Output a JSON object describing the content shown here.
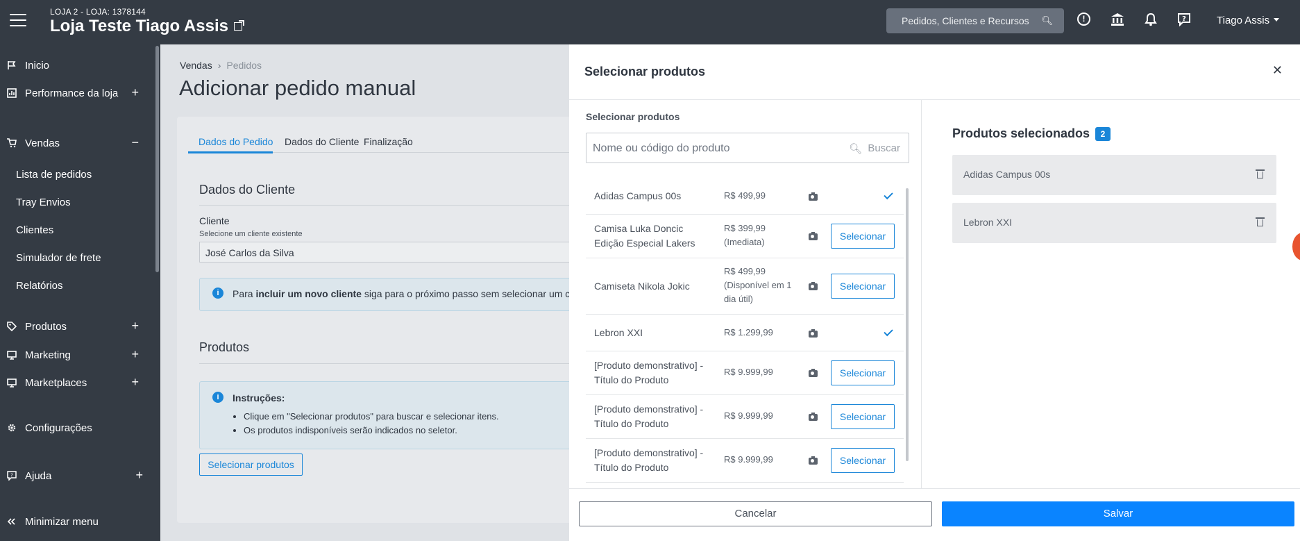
{
  "header": {
    "store_code": "LOJA 2 - LOJA: 1378144",
    "store_name": "Loja Teste Tiago Assis",
    "search_placeholder": "Pedidos, Clientes e Recursos",
    "user_name": "Tiago Assis"
  },
  "sidebar": {
    "items": [
      {
        "label": "Inicio",
        "icon": "flag-icon",
        "toggle": ""
      },
      {
        "label": "Performance da loja",
        "icon": "chart-icon",
        "toggle": "+"
      },
      {
        "label": "Vendas",
        "icon": "cart-icon",
        "toggle": "−"
      },
      {
        "label": "Produtos",
        "icon": "tag-icon",
        "toggle": "+"
      },
      {
        "label": "Marketing",
        "icon": "monitor-icon",
        "toggle": "+"
      },
      {
        "label": "Marketplaces",
        "icon": "monitor-icon",
        "toggle": "+"
      },
      {
        "label": "Configurações",
        "icon": "gear-icon",
        "toggle": ""
      },
      {
        "label": "Ajuda",
        "icon": "chat-help-icon",
        "toggle": "+"
      },
      {
        "label": "Minimizar menu",
        "icon": "double-chevron-left-icon",
        "toggle": ""
      }
    ],
    "vendas_sub": [
      "Lista de pedidos",
      "Tray Envios",
      "Clientes",
      "Simulador de frete",
      "Relatórios"
    ]
  },
  "main": {
    "breadcrumb": [
      "Vendas",
      "Pedidos"
    ],
    "title": "Adicionar pedido manual",
    "tabs": [
      "Dados do Pedido",
      "Dados do Cliente",
      "Finalização"
    ],
    "cliente_section": "Dados do Cliente",
    "cliente_label": "Cliente",
    "cliente_help": "Selecione um cliente existente",
    "cliente_value": "José Carlos da Silva",
    "info_prefix": "Para ",
    "info_bold": "incluir um novo cliente",
    "info_suffix": " siga para o próximo passo sem selecionar um cli",
    "produtos_section": "Produtos",
    "instructions_title": "Instruções:",
    "instructions": [
      "Clique em \"Selecionar produtos\" para buscar e selecionar itens.",
      "Os produtos indisponíveis serão indicados no seletor."
    ],
    "select_products_button": "Selecionar produtos"
  },
  "modal": {
    "title": "Selecionar produtos",
    "left_label": "Selecionar produtos",
    "search_placeholder": "Nome ou código do produto",
    "search_button": "Buscar",
    "select_label": "Selecionar",
    "products": [
      {
        "name": "Adidas Campus 00s",
        "price": "R$ 499,99",
        "selected": true
      },
      {
        "name": "Camisa Luka Doncic Edição Especial Lakers",
        "price": "R$ 399,99 (Imediata)",
        "selected": false
      },
      {
        "name": "Camiseta Nikola Jokic",
        "price": "R$ 499,99 (Disponível em 1 dia útil)",
        "selected": false
      },
      {
        "name": "Lebron XXI",
        "price": "R$ 1.299,99",
        "selected": true
      },
      {
        "name": "[Produto demonstrativo] - Título do Produto",
        "price": "R$ 9.999,99",
        "selected": false
      },
      {
        "name": "[Produto demonstrativo] - Título do Produto",
        "price": "R$ 9.999,99",
        "selected": false
      },
      {
        "name": "[Produto demonstrativo] - Título do Produto",
        "price": "R$ 9.999,99",
        "selected": false
      }
    ],
    "selected_title": "Produtos selecionados",
    "selected_count": "2",
    "selected_items": [
      "Adidas Campus 00s",
      "Lebron XXI"
    ],
    "cancel": "Cancelar",
    "save": "Salvar"
  },
  "colors": {
    "accent": "#1a86d8",
    "save": "#0a84ff",
    "topbar": "#343b44"
  }
}
